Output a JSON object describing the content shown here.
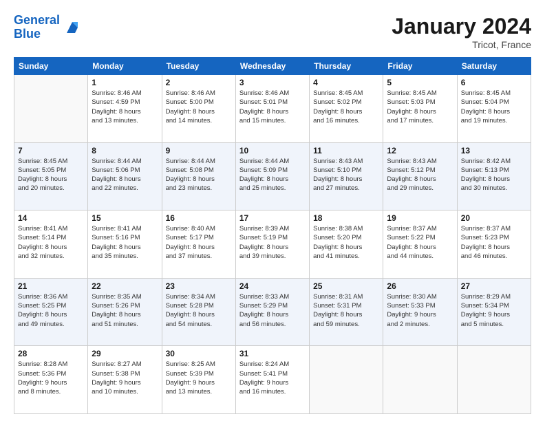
{
  "header": {
    "logo_line1": "General",
    "logo_line2": "Blue",
    "title": "January 2024",
    "subtitle": "Tricot, France"
  },
  "weekdays": [
    "Sunday",
    "Monday",
    "Tuesday",
    "Wednesday",
    "Thursday",
    "Friday",
    "Saturday"
  ],
  "rows": [
    {
      "rowClass": "row-1",
      "cells": [
        {
          "empty": true
        },
        {
          "day": "1",
          "info": "Sunrise: 8:46 AM\nSunset: 4:59 PM\nDaylight: 8 hours\nand 13 minutes."
        },
        {
          "day": "2",
          "info": "Sunrise: 8:46 AM\nSunset: 5:00 PM\nDaylight: 8 hours\nand 14 minutes."
        },
        {
          "day": "3",
          "info": "Sunrise: 8:46 AM\nSunset: 5:01 PM\nDaylight: 8 hours\nand 15 minutes."
        },
        {
          "day": "4",
          "info": "Sunrise: 8:45 AM\nSunset: 5:02 PM\nDaylight: 8 hours\nand 16 minutes."
        },
        {
          "day": "5",
          "info": "Sunrise: 8:45 AM\nSunset: 5:03 PM\nDaylight: 8 hours\nand 17 minutes."
        },
        {
          "day": "6",
          "info": "Sunrise: 8:45 AM\nSunset: 5:04 PM\nDaylight: 8 hours\nand 19 minutes."
        }
      ]
    },
    {
      "rowClass": "row-2",
      "cells": [
        {
          "day": "7",
          "info": "Sunrise: 8:45 AM\nSunset: 5:05 PM\nDaylight: 8 hours\nand 20 minutes."
        },
        {
          "day": "8",
          "info": "Sunrise: 8:44 AM\nSunset: 5:06 PM\nDaylight: 8 hours\nand 22 minutes."
        },
        {
          "day": "9",
          "info": "Sunrise: 8:44 AM\nSunset: 5:08 PM\nDaylight: 8 hours\nand 23 minutes."
        },
        {
          "day": "10",
          "info": "Sunrise: 8:44 AM\nSunset: 5:09 PM\nDaylight: 8 hours\nand 25 minutes."
        },
        {
          "day": "11",
          "info": "Sunrise: 8:43 AM\nSunset: 5:10 PM\nDaylight: 8 hours\nand 27 minutes."
        },
        {
          "day": "12",
          "info": "Sunrise: 8:43 AM\nSunset: 5:12 PM\nDaylight: 8 hours\nand 29 minutes."
        },
        {
          "day": "13",
          "info": "Sunrise: 8:42 AM\nSunset: 5:13 PM\nDaylight: 8 hours\nand 30 minutes."
        }
      ]
    },
    {
      "rowClass": "row-3",
      "cells": [
        {
          "day": "14",
          "info": "Sunrise: 8:41 AM\nSunset: 5:14 PM\nDaylight: 8 hours\nand 32 minutes."
        },
        {
          "day": "15",
          "info": "Sunrise: 8:41 AM\nSunset: 5:16 PM\nDaylight: 8 hours\nand 35 minutes."
        },
        {
          "day": "16",
          "info": "Sunrise: 8:40 AM\nSunset: 5:17 PM\nDaylight: 8 hours\nand 37 minutes."
        },
        {
          "day": "17",
          "info": "Sunrise: 8:39 AM\nSunset: 5:19 PM\nDaylight: 8 hours\nand 39 minutes."
        },
        {
          "day": "18",
          "info": "Sunrise: 8:38 AM\nSunset: 5:20 PM\nDaylight: 8 hours\nand 41 minutes."
        },
        {
          "day": "19",
          "info": "Sunrise: 8:37 AM\nSunset: 5:22 PM\nDaylight: 8 hours\nand 44 minutes."
        },
        {
          "day": "20",
          "info": "Sunrise: 8:37 AM\nSunset: 5:23 PM\nDaylight: 8 hours\nand 46 minutes."
        }
      ]
    },
    {
      "rowClass": "row-4",
      "cells": [
        {
          "day": "21",
          "info": "Sunrise: 8:36 AM\nSunset: 5:25 PM\nDaylight: 8 hours\nand 49 minutes."
        },
        {
          "day": "22",
          "info": "Sunrise: 8:35 AM\nSunset: 5:26 PM\nDaylight: 8 hours\nand 51 minutes."
        },
        {
          "day": "23",
          "info": "Sunrise: 8:34 AM\nSunset: 5:28 PM\nDaylight: 8 hours\nand 54 minutes."
        },
        {
          "day": "24",
          "info": "Sunrise: 8:33 AM\nSunset: 5:29 PM\nDaylight: 8 hours\nand 56 minutes."
        },
        {
          "day": "25",
          "info": "Sunrise: 8:31 AM\nSunset: 5:31 PM\nDaylight: 8 hours\nand 59 minutes."
        },
        {
          "day": "26",
          "info": "Sunrise: 8:30 AM\nSunset: 5:33 PM\nDaylight: 9 hours\nand 2 minutes."
        },
        {
          "day": "27",
          "info": "Sunrise: 8:29 AM\nSunset: 5:34 PM\nDaylight: 9 hours\nand 5 minutes."
        }
      ]
    },
    {
      "rowClass": "row-5",
      "cells": [
        {
          "day": "28",
          "info": "Sunrise: 8:28 AM\nSunset: 5:36 PM\nDaylight: 9 hours\nand 8 minutes."
        },
        {
          "day": "29",
          "info": "Sunrise: 8:27 AM\nSunset: 5:38 PM\nDaylight: 9 hours\nand 10 minutes."
        },
        {
          "day": "30",
          "info": "Sunrise: 8:25 AM\nSunset: 5:39 PM\nDaylight: 9 hours\nand 13 minutes."
        },
        {
          "day": "31",
          "info": "Sunrise: 8:24 AM\nSunset: 5:41 PM\nDaylight: 9 hours\nand 16 minutes."
        },
        {
          "empty": true
        },
        {
          "empty": true
        },
        {
          "empty": true
        }
      ]
    }
  ]
}
